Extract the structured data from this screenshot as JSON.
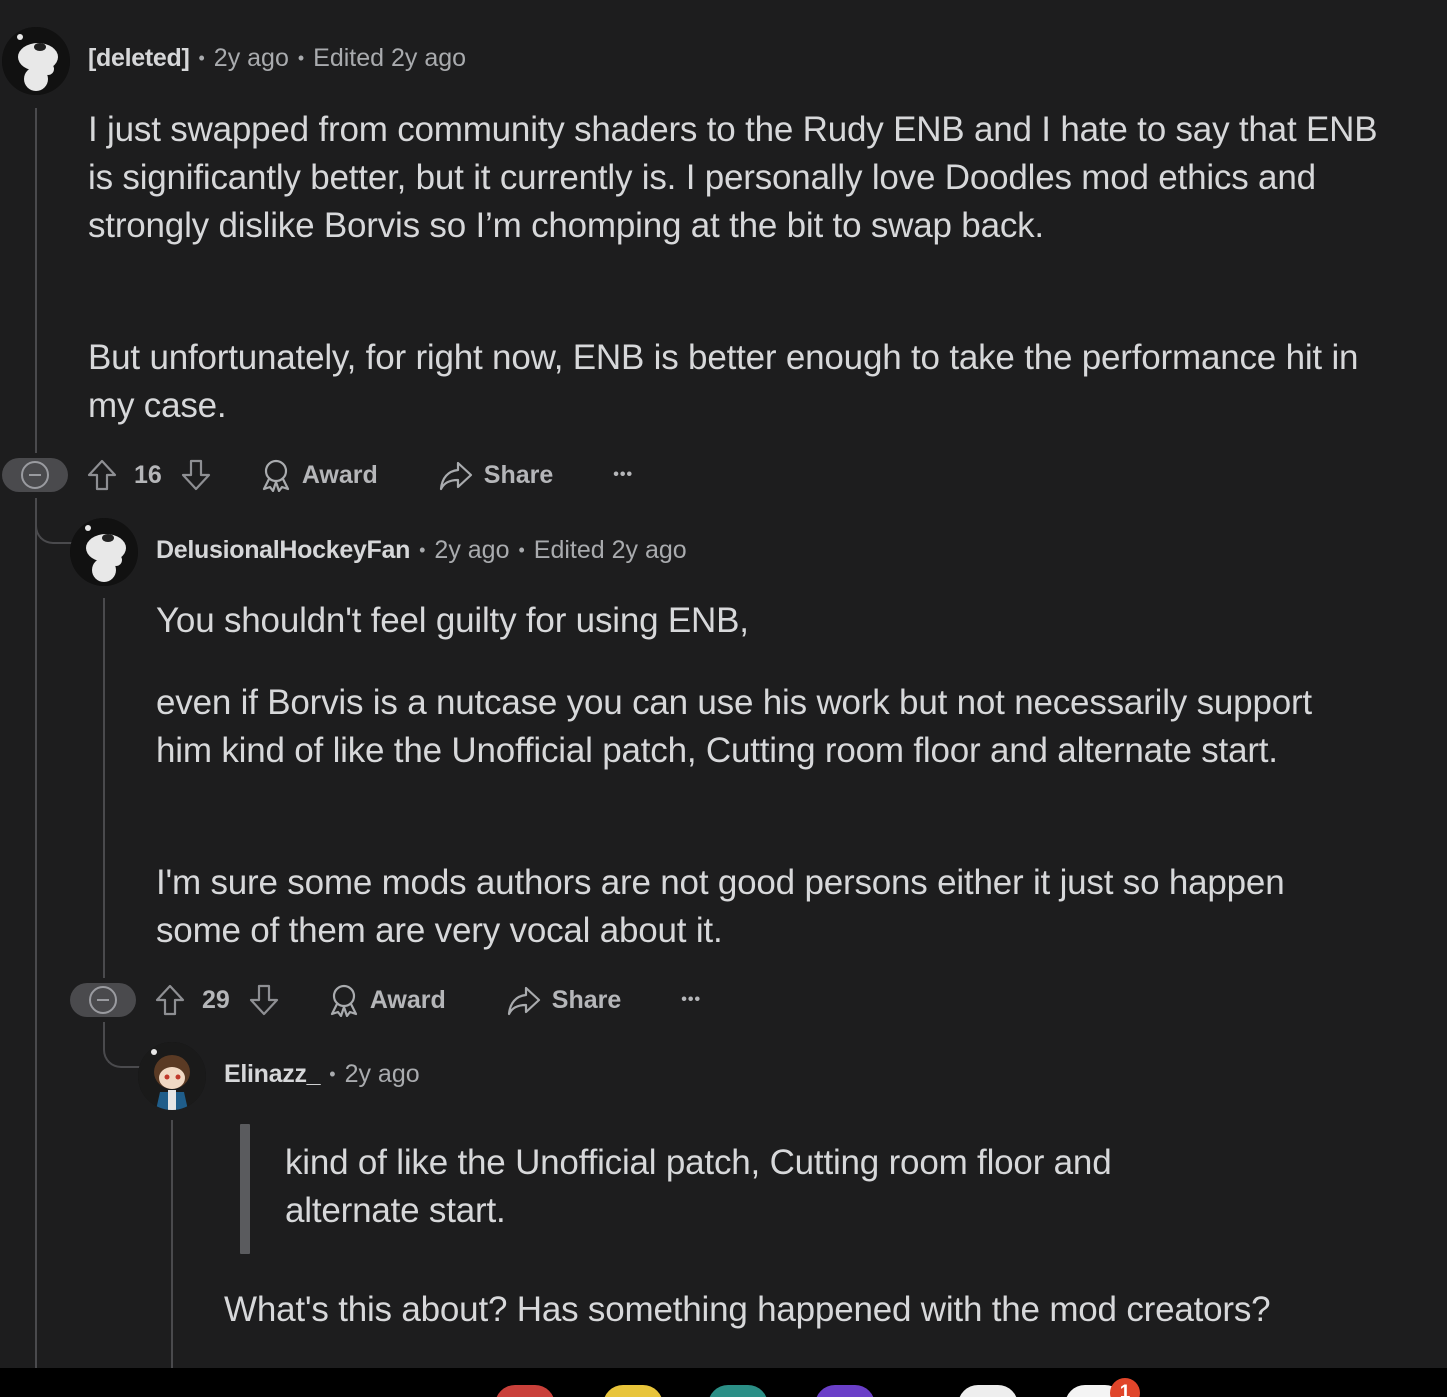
{
  "comments": [
    {
      "author": "[deleted]",
      "age": "2y ago",
      "edited": "Edited 2y ago",
      "paragraphs": [
        "I just swapped from community shaders to the Rudy ENB and I hate to say that ENB is significantly better, but it currently is. I personally love Doodles mod ethics and strongly dislike Borvis so I’m chomping at the bit to swap back.",
        "But unfortunately, for right now, ENB is better enough to take the performance hit in my case."
      ],
      "votes": "16",
      "award_label": "Award",
      "share_label": "Share",
      "more_label": "•••"
    },
    {
      "author": "DelusionalHockeyFan",
      "age": "2y ago",
      "edited": "Edited 2y ago",
      "paragraphs": [
        "You shouldn't feel guilty for using ENB,",
        "even if Borvis is a nutcase you can use his work but not necessarily support him kind of like the Unofficial patch, Cutting room floor and alternate start.",
        "I'm sure some mods authors are not good persons either it just so happen some of them are very vocal about it."
      ],
      "votes": "29",
      "award_label": "Award",
      "share_label": "Share",
      "more_label": "•••"
    },
    {
      "author": "Elinazz_",
      "age": "2y ago",
      "quote": "kind of like the Unofficial patch, Cutting room floor and alternate start.",
      "paragraphs": [
        "What's this about? Has something happened with the mod creators?"
      ]
    }
  ],
  "separator": "•",
  "dock": {
    "notification_count": "1"
  },
  "colors": {
    "background": "#1d1d1e",
    "thread_line": "#4a4a4d",
    "text": "#d7d8da",
    "meta": "#a9abae",
    "badge": "#e0452a"
  },
  "icons": [
    "snoo-avatar",
    "anime-avatar",
    "upvote-icon",
    "downvote-icon",
    "award-icon",
    "share-icon",
    "more-icon",
    "collapse-icon"
  ]
}
